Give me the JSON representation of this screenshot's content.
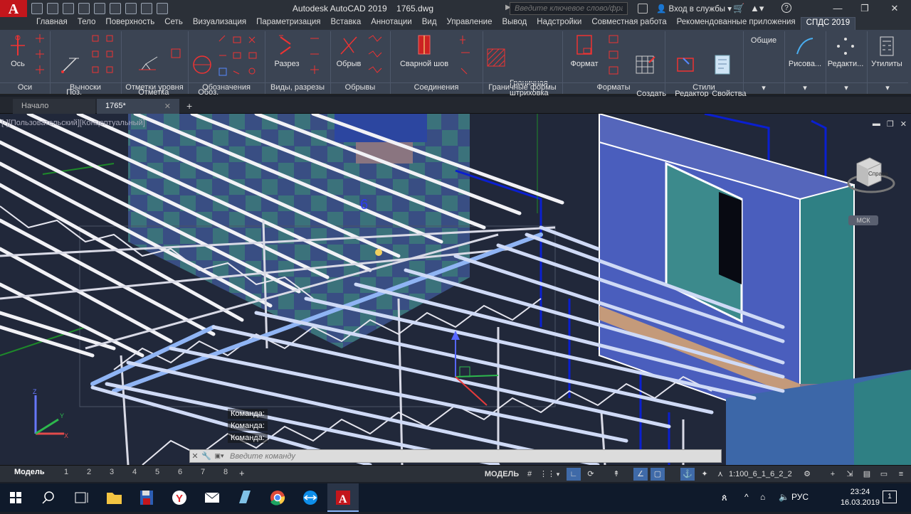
{
  "titlebar": {
    "app_title": "Autodesk AutoCAD 2019",
    "file_name": "1765.dwg",
    "search_placeholder": "Введите ключевое слово/фразу",
    "sign_in": "Вход в службы",
    "help": "?"
  },
  "ribbon_tabs": [
    "Главная",
    "Тело",
    "Поверхность",
    "Сеть",
    "Визуализация",
    "Параметризация",
    "Вставка",
    "Аннотации",
    "Вид",
    "Управление",
    "Вывод",
    "Надстройки",
    "Совместная работа",
    "Рекомендованные приложения",
    "СПДС 2019"
  ],
  "active_tab": "СПДС 2019",
  "ribbon": {
    "axes": {
      "tool": "Ось",
      "panel": "Оси"
    },
    "callouts": {
      "tool": "Поз.\nвыноска",
      "panel": "Выноски"
    },
    "levels": {
      "tool": "Отметка\nуровня",
      "panel": "Отметки уровня"
    },
    "designations": {
      "tool": "Обоз.\nузла",
      "panel": "Обозначения"
    },
    "sections": {
      "tool": "Разрез",
      "panel": "Виды, разрезы"
    },
    "breaks": {
      "tool": "Обрыв",
      "panel": "Обрывы"
    },
    "joints": {
      "tool": "Сварной шов",
      "panel": "Соединения"
    },
    "boundary": {
      "tool": "Граничная\nштриховка",
      "panel": "Граничные формы"
    },
    "formats": {
      "tool1": "Формат",
      "tool2": "Создать\nтаблицу",
      "panel": "Форматы"
    },
    "styles": {
      "tool1": "Редактор\nстилей",
      "tool2": "Свойства\nСПДС",
      "panel": "Стили"
    },
    "general": {
      "tool": "Общие"
    },
    "draw": {
      "tool": "Рисова..."
    },
    "edit": {
      "tool": "Редакти..."
    },
    "utils": {
      "tool": "Утилиты"
    }
  },
  "doc_tabs": [
    {
      "label": "Начало"
    },
    {
      "label": "1765*"
    }
  ],
  "viewport": {
    "caption": "[-][Пользовательский][Концептуальный]",
    "viewcube_face": "Справа",
    "ucs_label": "МСК",
    "grid_label": "6"
  },
  "command": {
    "history": [
      "Команда:",
      "Команда:",
      "Команда:"
    ],
    "placeholder": "Введите команду"
  },
  "layout_tabs": [
    "Модель",
    "1",
    "2",
    "3",
    "4",
    "5",
    "6",
    "7",
    "8"
  ],
  "status": {
    "space": "МОДЕЛЬ",
    "scale": "1:100_6_1_6_2_2"
  },
  "taskbar": {
    "language": "РУС",
    "time": "23:24",
    "date": "16.03.2019"
  },
  "colors": {
    "accent_red": "#c3161c",
    "ribbon_bg": "#3b4453",
    "viewport_bg": "#21283a"
  }
}
